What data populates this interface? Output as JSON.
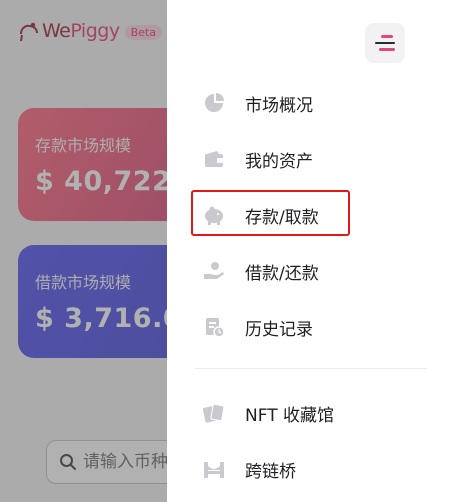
{
  "app": {
    "logo_prefix": "We",
    "logo_suffix": "Piggy",
    "beta_label": "Beta"
  },
  "cards": {
    "deposit": {
      "title": "存款市场规模",
      "value": "$ 40,722"
    },
    "borrow": {
      "title": "借款市场规模",
      "value": "$ 3,716.0"
    }
  },
  "search": {
    "placeholder": "请输入币种"
  },
  "drawer": {
    "items": [
      {
        "label": "市场概况",
        "icon": "pie-chart-icon"
      },
      {
        "label": "我的资产",
        "icon": "wallet-icon"
      },
      {
        "label": "存款/取款",
        "icon": "piggy-bank-icon"
      },
      {
        "label": "借款/还款",
        "icon": "hand-coin-icon"
      },
      {
        "label": "历史记录",
        "icon": "history-document-icon"
      },
      {
        "label": "NFT 收藏馆",
        "icon": "nft-cards-icon"
      },
      {
        "label": "跨链桥",
        "icon": "bridge-icon"
      }
    ],
    "highlighted_item": "存款/取款"
  },
  "colors": {
    "brand_pink": "#e5457a",
    "deposit_card": "#e0577f",
    "borrow_card": "#5353dc",
    "highlight_border": "#e11919",
    "menu_icon_gray": "#c9c9cf"
  }
}
